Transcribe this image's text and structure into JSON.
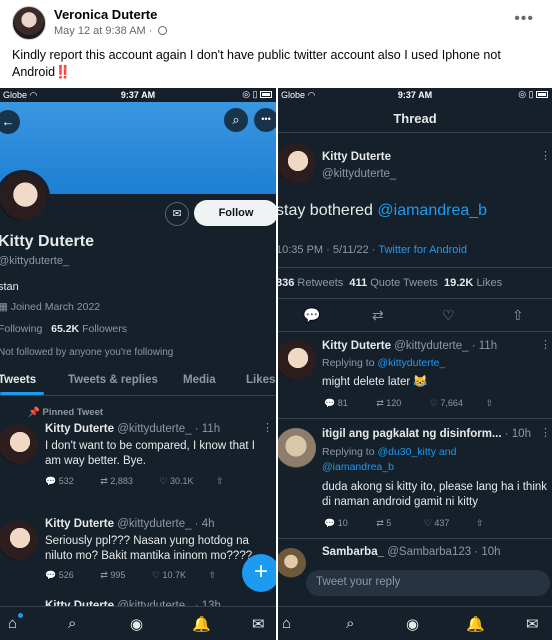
{
  "post": {
    "author": "Veronica Duterte",
    "date": "May 12 at 9:38 AM",
    "date_sep": "·",
    "more": "•••",
    "text": "Kindly report this account again I don't have public twitter account also I used Iphone not Android",
    "emoji": "‼️"
  },
  "status": {
    "carrier": "Globe",
    "time": "9:37 AM"
  },
  "profile": {
    "back_icon": "←",
    "search_icon": "⌕",
    "more_icon": "•••",
    "mail_icon": "✉",
    "follow_label": "Follow",
    "name": "Kitty Duterte",
    "handle": "@kittyduterte_",
    "bio": "stan",
    "joined": "Joined March 2022",
    "following_count": "",
    "following_label": "Following",
    "followers_count": "65.2K",
    "followers_label": "Followers",
    "not_followed": "Not followed by anyone you're following"
  },
  "tabs": [
    "Tweets",
    "Tweets & replies",
    "Media",
    "Likes"
  ],
  "left_tweets": [
    {
      "pinned_label": "Pinned Tweet",
      "name": "Kitty Duterte",
      "handle_time": "@kittyduterte_ · 11h",
      "text": "I don't want to be compared, I know that I am way better. Bye.",
      "replies": "532",
      "retweets": "2,883",
      "likes": "30.1K"
    },
    {
      "name": "Kitty Duterte",
      "handle_time": "@kittyduterte_ · 4h",
      "text": "Seriously ppl??? Nasan yung hotdog na niluto mo? Bakit mantika ininom mo????",
      "replies": "526",
      "retweets": "995",
      "likes": "10.7K"
    },
    {
      "name": "Kitty Duterte",
      "handle_time": "@kittyduterte_ · 13h"
    }
  ],
  "fab_icon": "+",
  "thread": {
    "title": "Thread",
    "name": "Kitty Duterte",
    "handle": "@kittyduterte_",
    "text_prefix": "stay bothered ",
    "mention": "@iamandrea_b",
    "meta_time": "10:35 PM · 5/11/22 · ",
    "meta_source": "Twitter for Android",
    "retweets_count": "836",
    "retweets_label": "Retweets",
    "quotes_count": "411",
    "quotes_label": "Quote Tweets",
    "likes_count": "19.2K",
    "likes_label": "Likes",
    "replies": [
      {
        "name": "Kitty Duterte",
        "handle_time": "@kittyduterte_ · 11h",
        "replying_prefix": "Replying to ",
        "replying_to": "@kittyduterte_",
        "text": "might delete later 😹",
        "replies": "81",
        "retweets": "120",
        "likes": "7,664"
      },
      {
        "name": "itigil ang pagkalat ng disinform...",
        "handle_time": "· 10h",
        "replying_prefix": "Replying to ",
        "replying_to": "@du30_kitty and @iamandrea_b",
        "text": "duda akong si kitty ito, please lang ha i think di naman android gamit ni kitty",
        "replies": "10",
        "retweets": "5",
        "likes": "437"
      },
      {
        "name": "Sambarba_",
        "handle_time": "@Sambarba123 · 10h"
      }
    ],
    "reply_placeholder": "Tweet your reply"
  }
}
